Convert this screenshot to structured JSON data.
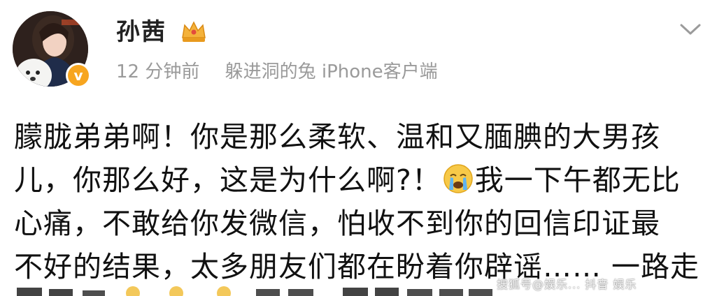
{
  "user": {
    "name": "孙茜",
    "time": "12 分钟前",
    "source": "躲进洞的兔 iPhone客户端",
    "verified_icon": "verified-badge-icon",
    "crown_icon": "crown-icon"
  },
  "post": {
    "lines": [
      "朦胧弟弟啊！你是那么柔软、温和又腼腆的大男孩",
      "儿，你那么好，这是为什么啊?！",
      "我一下午都无比",
      "心痛，不敢给你发微信，怕收不到你的回信印证最",
      "不好的结果，太多朋友们都在盼着你辟谣…… 一路走"
    ],
    "emoji": "crying-face-icon"
  },
  "watermark": "搜狐号@娱乐... 抖音 娱乐"
}
